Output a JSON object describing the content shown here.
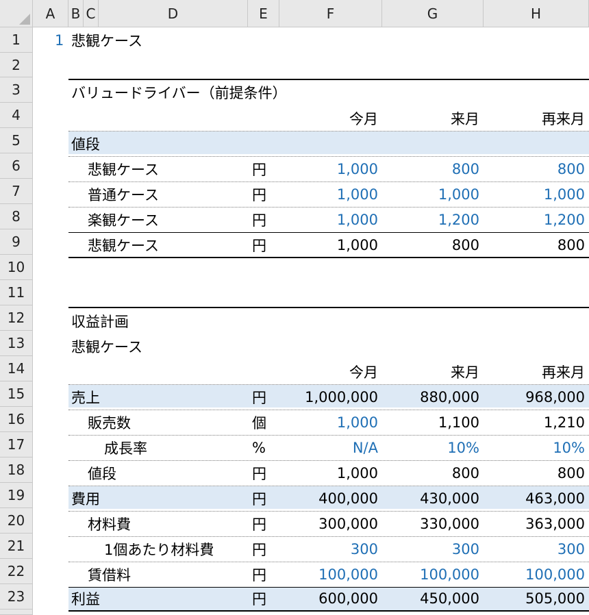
{
  "columns": [
    "A",
    "B",
    "C",
    "D",
    "E",
    "F",
    "G",
    "H"
  ],
  "rows": [
    "1",
    "2",
    "3",
    "4",
    "5",
    "6",
    "7",
    "8",
    "9",
    "10",
    "11",
    "12",
    "13",
    "14",
    "15",
    "16",
    "17",
    "18",
    "19",
    "20",
    "21",
    "22",
    "23"
  ],
  "sheet": {
    "r1": {
      "num": "1",
      "title": "悲観ケース"
    },
    "r3": {
      "title": "バリュードライバー（前提条件）"
    },
    "r4": {
      "f": "今月",
      "g": "来月",
      "h": "再来月"
    },
    "r5": {
      "label": "値段"
    },
    "r6": {
      "label": "悲観ケース",
      "unit": "円",
      "f": "1,000",
      "g": "800",
      "h": "800"
    },
    "r7": {
      "label": "普通ケース",
      "unit": "円",
      "f": "1,000",
      "g": "1,000",
      "h": "1,000"
    },
    "r8": {
      "label": "楽観ケース",
      "unit": "円",
      "f": "1,000",
      "g": "1,200",
      "h": "1,200"
    },
    "r9": {
      "label": "悲観ケース",
      "unit": "円",
      "f": "1,000",
      "g": "800",
      "h": "800"
    },
    "r12": {
      "title": "収益計画"
    },
    "r13": {
      "title": "悲観ケース"
    },
    "r14": {
      "f": "今月",
      "g": "来月",
      "h": "再来月"
    },
    "r15": {
      "label": "売上",
      "unit": "円",
      "f": "1,000,000",
      "g": "880,000",
      "h": "968,000"
    },
    "r16": {
      "label": "販売数",
      "unit": "個",
      "f": "1,000",
      "g": "1,100",
      "h": "1,210"
    },
    "r17": {
      "label": "成長率",
      "unit": "%",
      "f": "N/A",
      "g": "10%",
      "h": "10%"
    },
    "r18": {
      "label": "値段",
      "unit": "円",
      "f": "1,000",
      "g": "800",
      "h": "800"
    },
    "r19": {
      "label": "費用",
      "unit": "円",
      "f": "400,000",
      "g": "430,000",
      "h": "463,000"
    },
    "r20": {
      "label": "材料費",
      "unit": "円",
      "f": "300,000",
      "g": "330,000",
      "h": "363,000"
    },
    "r21": {
      "label": "1個あたり材料費",
      "unit": "円",
      "f": "300",
      "g": "300",
      "h": "300"
    },
    "r22": {
      "label": "賃借料",
      "unit": "円",
      "f": "100,000",
      "g": "100,000",
      "h": "100,000"
    },
    "r23": {
      "label": "利益",
      "unit": "円",
      "f": "600,000",
      "g": "450,000",
      "h": "505,000"
    }
  },
  "colors": {
    "input_blue": "#1f6fb5",
    "band": "#dde9f5",
    "header_bg": "#e8e8e8"
  }
}
